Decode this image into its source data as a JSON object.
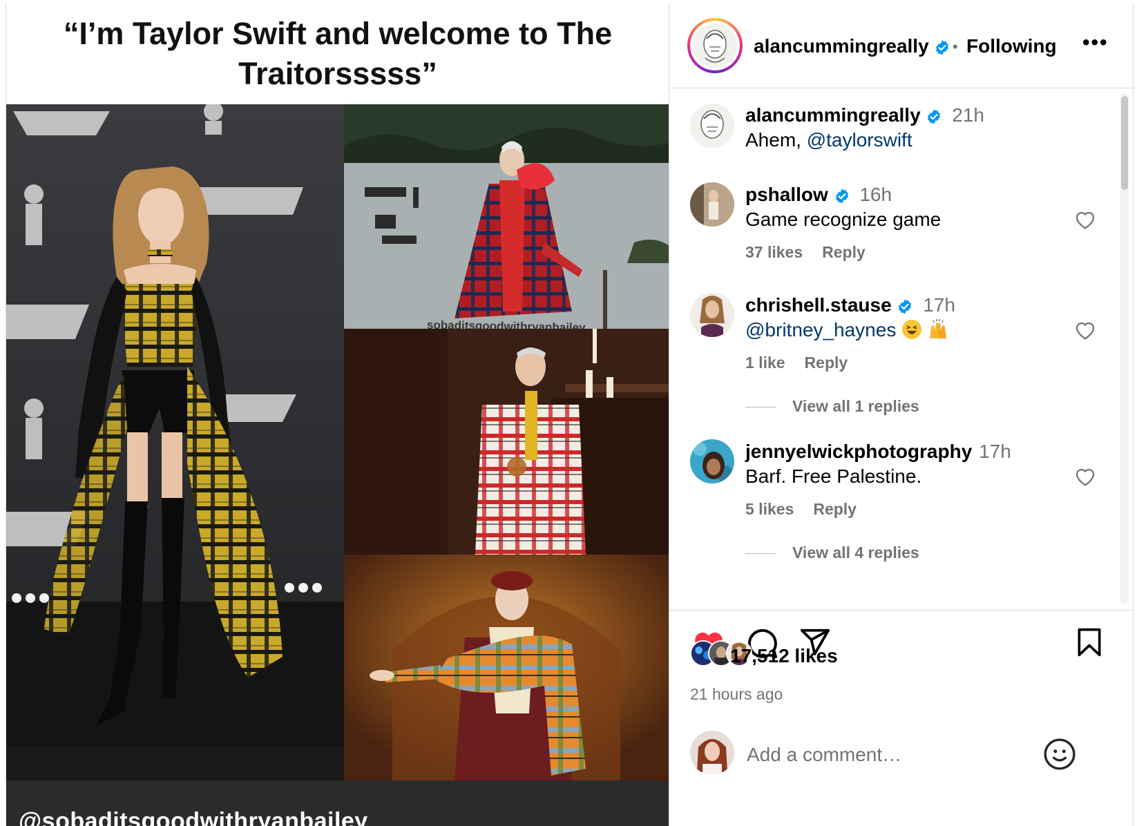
{
  "post": {
    "meme_caption": "“I’m Taylor Swift and welcome to The Traitorsssss”",
    "watermark": "sobaditsgoodwithryanbailey",
    "credit": "@sobaditsgoodwithryanbailey"
  },
  "header": {
    "username": "alancummingreally",
    "separator": "•",
    "follow_state": "Following",
    "more": "•••"
  },
  "comments": [
    {
      "user": "alancummingreally",
      "verified": true,
      "time": "21h",
      "mention": "@taylorswift",
      "text_before": "Ahem, ",
      "text_after": ""
    },
    {
      "user": "pshallow",
      "verified": true,
      "time": "16h",
      "text": "Game recognize game",
      "likes": "37 likes",
      "reply": "Reply"
    },
    {
      "user": "chrishell.stause",
      "verified": true,
      "time": "17h",
      "mention": "@britney_haynes",
      "likes": "1 like",
      "reply": "Reply",
      "view_replies": "View all 1 replies"
    },
    {
      "user": "jennyelwickphotography",
      "verified": false,
      "time": "17h",
      "text": "Barf. Free Palestine.",
      "likes": "5 likes",
      "reply": "Reply",
      "view_replies": "View all 4 replies"
    }
  ],
  "actions": {
    "like_icon": "heart-filled-icon",
    "comment_icon": "comment-icon",
    "share_icon": "send-icon",
    "save_icon": "bookmark-icon",
    "like_count": "17,512 likes",
    "posted": "21 hours ago"
  },
  "composer": {
    "placeholder": "Add a comment…",
    "emoji_icon": "smiley-icon"
  },
  "colors": {
    "like_red": "#ff3040",
    "mention_blue": "#00376b",
    "verified_blue": "#0095f6",
    "muted": "#737373"
  }
}
